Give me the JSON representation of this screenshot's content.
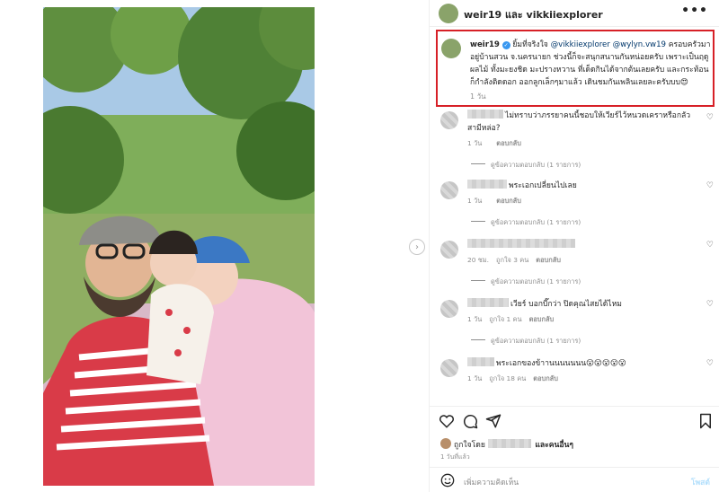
{
  "header": {
    "title": "weir19 และ vikkiiexplorer",
    "more": "•••"
  },
  "caption": {
    "user": "weir19",
    "text_1": " ยิ้มที่จริงใจ ",
    "mention_1": "@vikkiiexplorer",
    "mention_2": "@wylyn.vw19",
    "text_2": " ครอบครัวมาอยู่บ้านสวน จ.นครนายก ช่วงนี้ก็จะสนุกสนานกันหน่อยครับ เพราะเป็นฤดูผลไม้ ทั้งมะยงชิด มะปรางหวาน ที่เด็ดกินได้จากต้นเลยครับ และกระท้อน ก็กำลังติดดอก ออกลูกเล็กๆมาแล้ว เดินชมกันเพลินเลยละครับบบ😍",
    "time": "1 วัน"
  },
  "comments": [
    {
      "text": "ไม่ทราบว่าภรรยาคนนี้ชอบให้เวียร์ไว้หนวดเคราหรือกลัวสามีหล่อ?",
      "time": "1 วัน",
      "likes": "",
      "reply": "ตอบกลับ",
      "view_replies": "ดูข้อความตอบกลับ (1 รายการ)"
    },
    {
      "text": "พระเอกเปลี่ยนไปเลย",
      "time": "1 วัน",
      "likes": "",
      "reply": "ตอบกลับ",
      "view_replies": "ดูข้อความตอบกลับ (1 รายการ)"
    },
    {
      "text": "",
      "time": "20 ชม.",
      "likes": "ถูกใจ 3 คน",
      "reply": "ตอบกลับ",
      "view_replies": "ดูข้อความตอบกลับ (1 รายการ)"
    },
    {
      "text": "เวียร์ บอกบี๊กว่า ปิดคุณไสยได้ไหม",
      "time": "1 วัน",
      "likes": "ถูกใจ 1 คน",
      "reply": "ตอบกลับ",
      "view_replies": "ดูข้อความตอบกลับ (1 รายการ)"
    },
    {
      "text": "พระเอกของข้าานนนนนนน😮😮😮😮😮",
      "time": "1 วัน",
      "likes": "ถูกใจ 18 คน",
      "reply": "ตอบกลับ",
      "view_replies": ""
    }
  ],
  "liked_by": {
    "prefix": "ถูกใจโดย",
    "suffix": "และคนอื่นๆ"
  },
  "post_time": "1 วันที่แล้ว",
  "add_comment": {
    "placeholder": "เพิ่มความคิดเห็น",
    "post_label": "โพสต์"
  },
  "icons": {
    "like": "heart-icon",
    "comment": "comment-icon",
    "share": "share-icon",
    "save": "bookmark-icon",
    "emoji": "emoji-icon",
    "next": "chevron-right-icon"
  },
  "colors": {
    "highlight_border": "#d72027",
    "mention": "#00376b",
    "verified": "#3897f0"
  }
}
